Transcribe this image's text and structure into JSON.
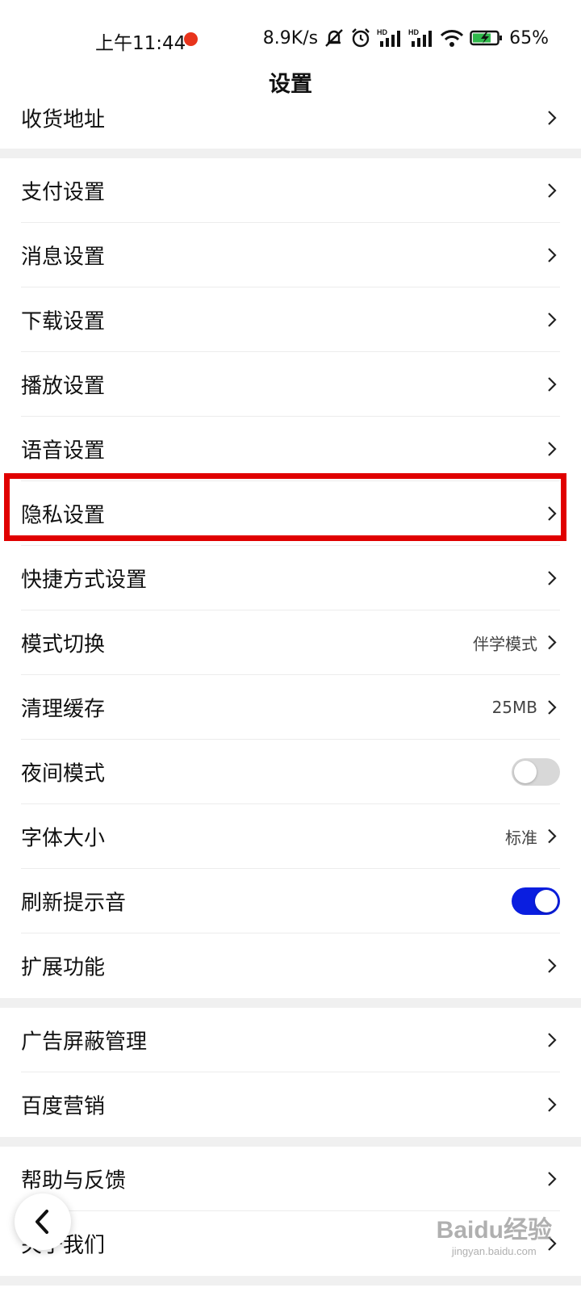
{
  "status_bar": {
    "time": "上午11:44",
    "network_speed": "8.9K/s",
    "battery": "65%",
    "icons": [
      "mute-bell-icon",
      "alarm-icon",
      "hd-signal-icon",
      "hd-signal-icon",
      "wifi-icon",
      "battery-charging-icon"
    ],
    "hd_label": "HD"
  },
  "header": {
    "title": "设置"
  },
  "sections": [
    {
      "items": [
        {
          "label": "收货地址"
        }
      ]
    },
    {
      "items": [
        {
          "label": "支付设置"
        },
        {
          "label": "消息设置"
        },
        {
          "label": "下载设置"
        },
        {
          "label": "播放设置"
        },
        {
          "label": "语音设置"
        },
        {
          "label": "隐私设置"
        },
        {
          "label": "快捷方式设置"
        },
        {
          "label": "模式切换",
          "value": "伴学模式"
        },
        {
          "label": "清理缓存",
          "value": "25MB"
        },
        {
          "label": "夜间模式",
          "toggle": false
        },
        {
          "label": "字体大小",
          "value": "标准"
        },
        {
          "label": "刷新提示音",
          "toggle": true
        },
        {
          "label": "扩展功能"
        }
      ]
    },
    {
      "items": [
        {
          "label": "广告屏蔽管理"
        },
        {
          "label": "百度营销"
        }
      ]
    },
    {
      "items": [
        {
          "label": "帮助与反馈"
        },
        {
          "label": "关于我们"
        }
      ]
    }
  ],
  "watermark": {
    "text": "Baidu经验",
    "subtext": "jingyan.baidu.com"
  },
  "colors": {
    "highlight": "#e00000",
    "toggle_on": "#0a1ee0",
    "status_dot": "#e8341c"
  }
}
